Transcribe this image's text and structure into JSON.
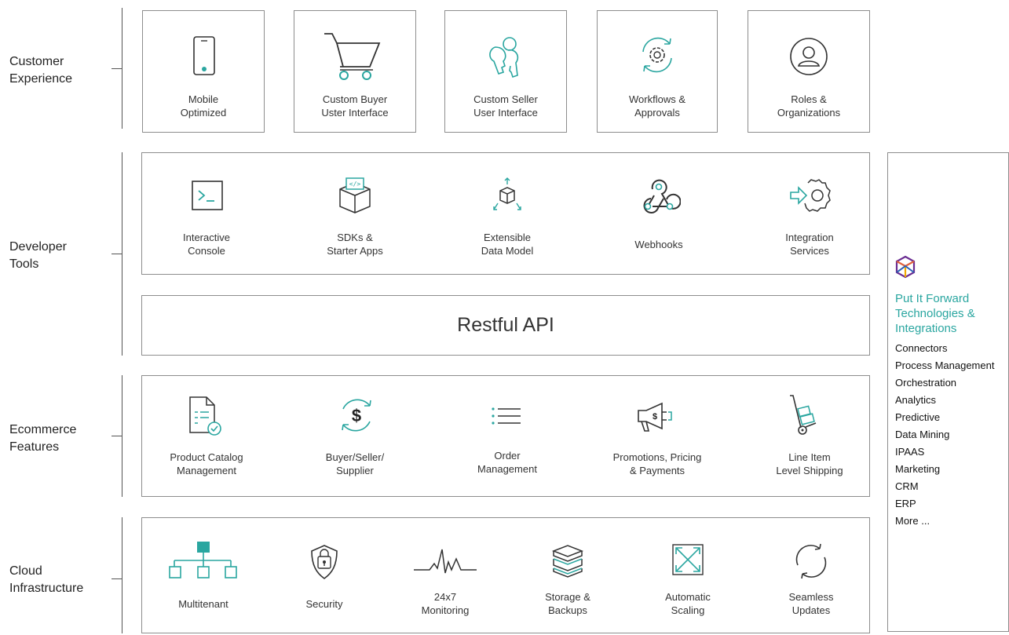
{
  "layers": [
    {
      "label": "Customer\nExperience"
    },
    {
      "label": "Developer\nTools"
    },
    {
      "label": "Ecommerce\nFeatures"
    },
    {
      "label": "Cloud\nInfrastructure"
    }
  ],
  "customer_experience": [
    {
      "label": "Mobile\nOptimized",
      "icon": "mobile-phone-icon"
    },
    {
      "label": "Custom Buyer\nUster Interface",
      "icon": "shopping-cart-icon"
    },
    {
      "label": "Custom Seller\nUser Interface",
      "icon": "keys-icon"
    },
    {
      "label": "Workflows &\nApprovals",
      "icon": "gear-cycle-icon"
    },
    {
      "label": "Roles &\nOrganizations",
      "icon": "user-circle-icon"
    }
  ],
  "developer_tools": [
    {
      "label": "Interactive\nConsole",
      "icon": "terminal-icon"
    },
    {
      "label": "SDKs &\nStarter Apps",
      "icon": "code-box-icon"
    },
    {
      "label": "Extensible\nData Model",
      "icon": "expand-cube-icon"
    },
    {
      "label": "Webhooks",
      "icon": "webhook-icon"
    },
    {
      "label": "Integration\nServices",
      "icon": "integration-gear-icon"
    }
  ],
  "api": {
    "label": "Restful API"
  },
  "ecommerce_features": [
    {
      "label": "Product Catalog\nManagement",
      "icon": "catalog-document-icon"
    },
    {
      "label": "Buyer/Seller/\nSupplier",
      "icon": "dollar-cycle-icon"
    },
    {
      "label": "Order\nManagement",
      "icon": "list-icon"
    },
    {
      "label": "Promotions, Pricing\n& Payments",
      "icon": "megaphone-icon"
    },
    {
      "label": "Line Item\nLevel Shipping",
      "icon": "hand-truck-icon"
    }
  ],
  "cloud_infrastructure": [
    {
      "label": "Multitenant",
      "icon": "hierarchy-icon"
    },
    {
      "label": "Security",
      "icon": "shield-lock-icon"
    },
    {
      "label": "24x7\nMonitoring",
      "icon": "pulse-icon"
    },
    {
      "label": "Storage &\nBackups",
      "icon": "storage-stack-icon"
    },
    {
      "label": "Automatic\nScaling",
      "icon": "scaling-arrows-icon"
    },
    {
      "label": "Seamless\nUpdates",
      "icon": "refresh-cycle-icon"
    }
  ],
  "sidebar": {
    "logo_icon": "put-it-forward-logo-icon",
    "title": "Put It Forward\nTechnologies &\nIntegrations",
    "items": [
      "Connectors",
      "Process Management",
      "Orchestration",
      "Analytics",
      "Predictive",
      "Data Mining",
      "IPAAS",
      "Marketing",
      "CRM",
      "ERP",
      "More ..."
    ]
  },
  "colors": {
    "accent": "#2aa6a0",
    "line": "#8d8d8d",
    "text": "#333333"
  }
}
